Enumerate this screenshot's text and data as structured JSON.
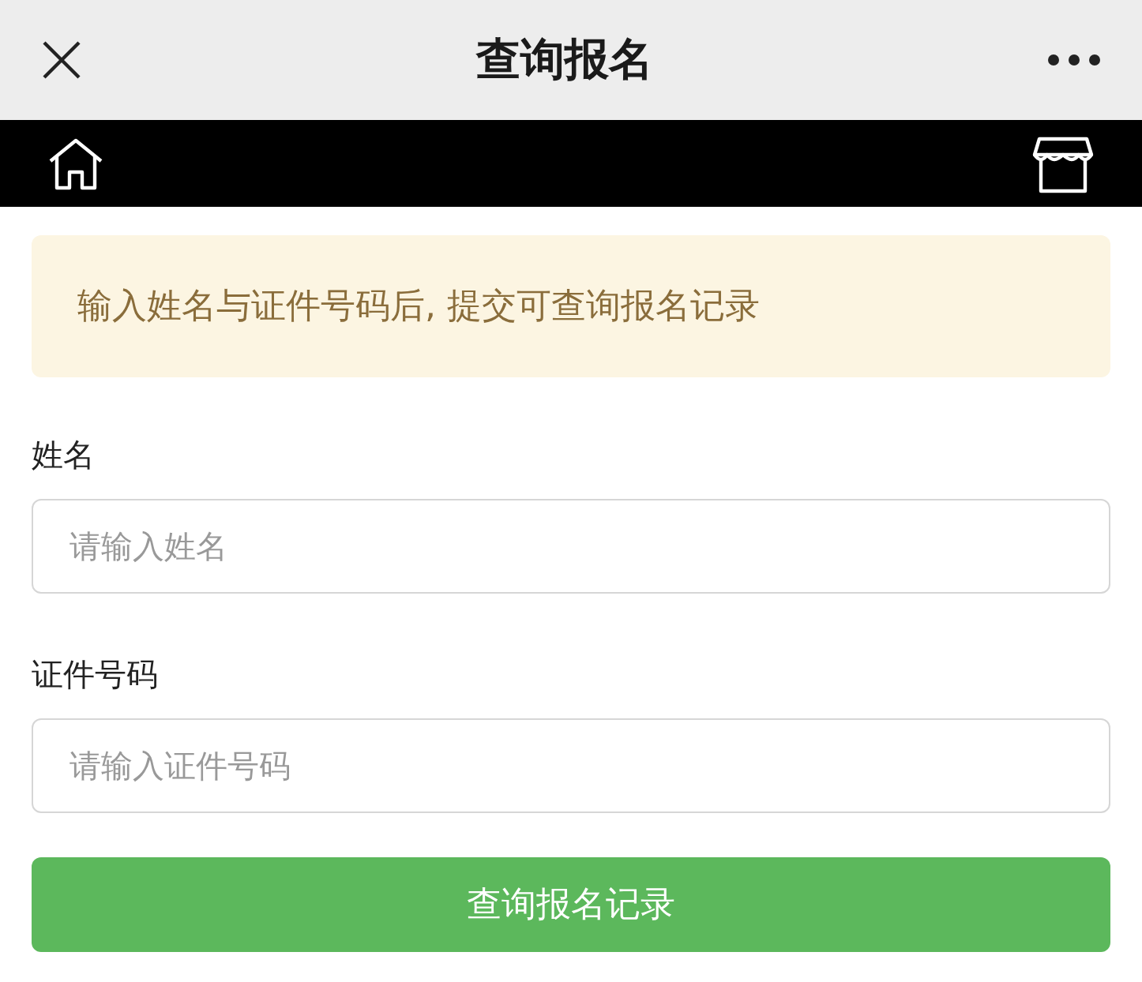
{
  "window": {
    "title": "查询报名"
  },
  "notice": "输入姓名与证件号码后, 提交可查询报名记录",
  "fields": [
    {
      "label": "姓名",
      "placeholder": "请输入姓名"
    },
    {
      "label": "证件号码",
      "placeholder": "请输入证件号码"
    }
  ],
  "submit_button": "查询报名记录"
}
